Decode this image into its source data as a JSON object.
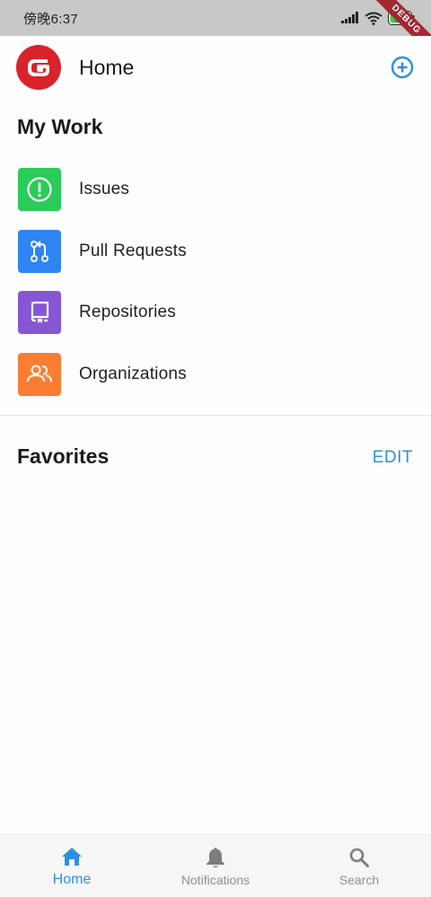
{
  "status_bar": {
    "time": "傍晚6:37",
    "battery": "77",
    "debug": "DEBUG"
  },
  "header": {
    "title": "Home"
  },
  "my_work": {
    "title": "My Work",
    "items": [
      {
        "label": "Issues",
        "icon": "issue-icon",
        "color": "#2bcb5a"
      },
      {
        "label": "Pull Requests",
        "icon": "pull-request-icon",
        "color": "#2f84f3"
      },
      {
        "label": "Repositories",
        "icon": "repo-icon",
        "color": "#8756d4"
      },
      {
        "label": "Organizations",
        "icon": "organization-icon",
        "color": "#fb7d34"
      }
    ]
  },
  "favorites": {
    "title": "Favorites",
    "edit_label": "EDIT"
  },
  "bottom_nav": {
    "items": [
      {
        "label": "Home",
        "icon": "home-icon",
        "active": true
      },
      {
        "label": "Notifications",
        "icon": "bell-icon",
        "active": false
      },
      {
        "label": "Search",
        "icon": "search-icon",
        "active": false
      }
    ]
  },
  "colors": {
    "accent": "#2d8fe4",
    "brand": "#d8232a",
    "debug_banner": "#a22832"
  }
}
